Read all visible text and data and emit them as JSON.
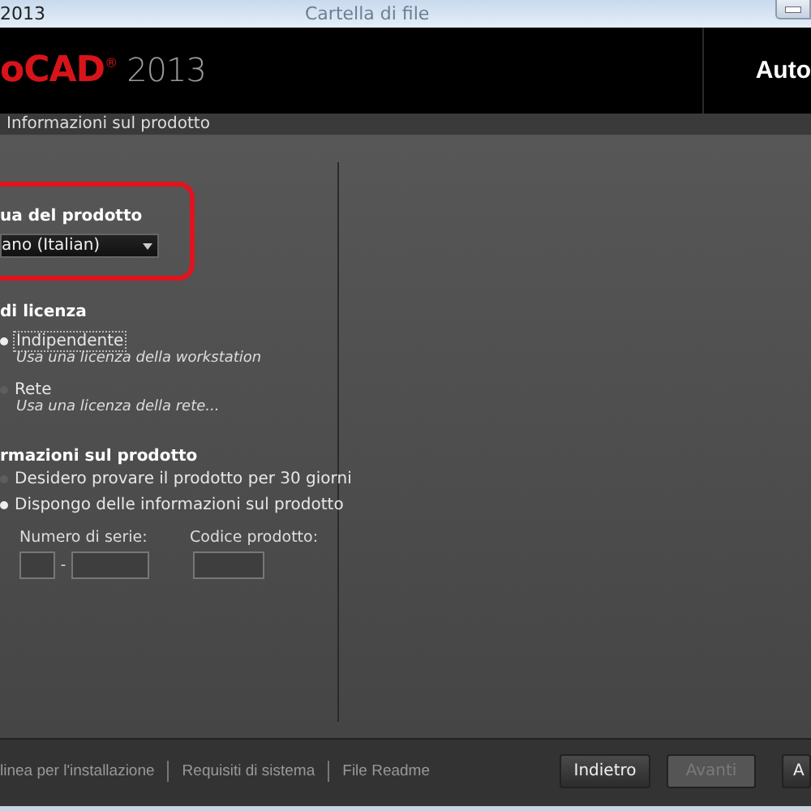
{
  "window": {
    "title": "2013",
    "background_text": "Cartella di file"
  },
  "header": {
    "logo_main": "oCAD",
    "logo_mark": "®",
    "logo_year": "2013",
    "brand": "Auto"
  },
  "breadcrumb": "Informazioni sul prodotto",
  "language": {
    "label": "ua del prodotto",
    "value": "ano (Italian)",
    "highlighted": true
  },
  "license": {
    "label": "di licenza",
    "options": [
      {
        "label": "Indipendente",
        "description": "Usa una licenza della workstation",
        "selected": true
      },
      {
        "label": "Rete",
        "description": "Usa una licenza della rete...",
        "selected": false
      }
    ]
  },
  "product_info": {
    "label": "rmazioni sul prodotto",
    "options": [
      {
        "label": "Desidero provare il prodotto per 30 giorni",
        "selected": false
      },
      {
        "label": "Dispongo delle informazioni sul prodotto",
        "selected": true
      }
    ],
    "serial_label": "Numero di serie:",
    "serial_separator": "-",
    "product_code_label": "Codice prodotto:"
  },
  "footer": {
    "links": [
      "linea per l'installazione",
      "Requisiti di sistema",
      "File Readme"
    ],
    "buttons": [
      {
        "label": "Indietro",
        "disabled": false
      },
      {
        "label": "Avanti",
        "disabled": true
      },
      {
        "label": "A",
        "disabled": false
      }
    ]
  }
}
